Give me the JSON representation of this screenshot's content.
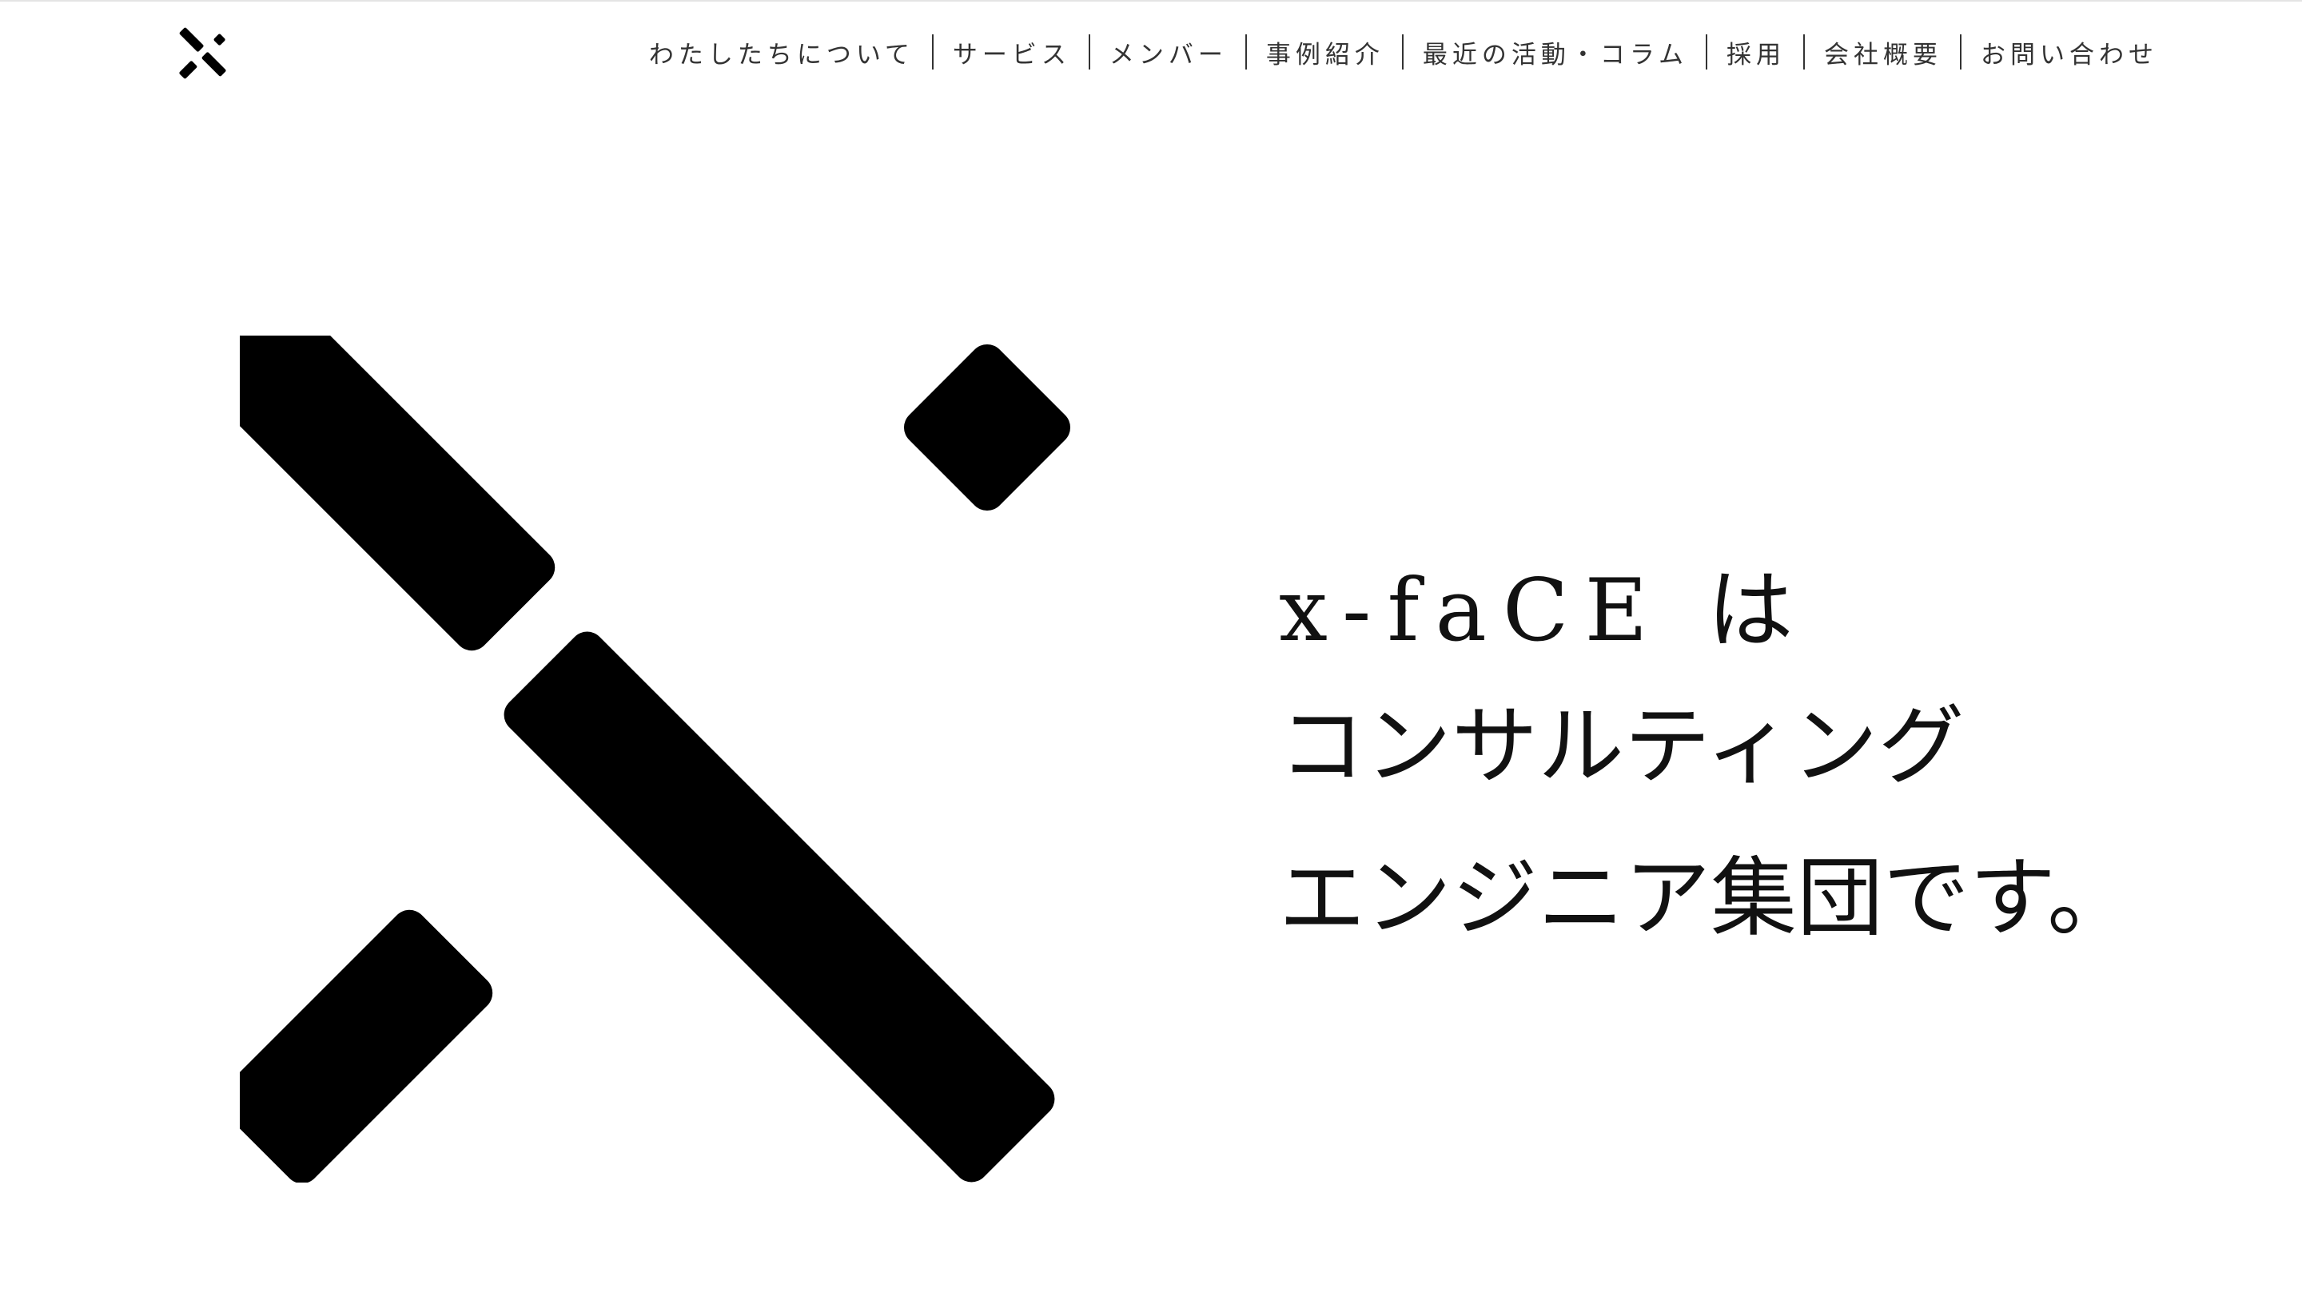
{
  "header": {
    "logo_icon": "x-face-mark-icon",
    "nav": [
      {
        "label": "わたしたちについて"
      },
      {
        "label": "サービス"
      },
      {
        "label": "メンバー"
      },
      {
        "label": "事例紹介"
      },
      {
        "label": "最近の活動・コラム"
      },
      {
        "label": "採用"
      },
      {
        "label": "会社概要"
      },
      {
        "label": "お問い合わせ"
      }
    ]
  },
  "hero": {
    "logo_icon": "x-face-large-mark-icon",
    "tagline": [
      "x-faCE は",
      "コンサルティング",
      "エンジニア集団です。"
    ]
  },
  "colors": {
    "mark": "#000000",
    "text": "#111111",
    "nav_text": "#333333",
    "background": "#ffffff"
  }
}
